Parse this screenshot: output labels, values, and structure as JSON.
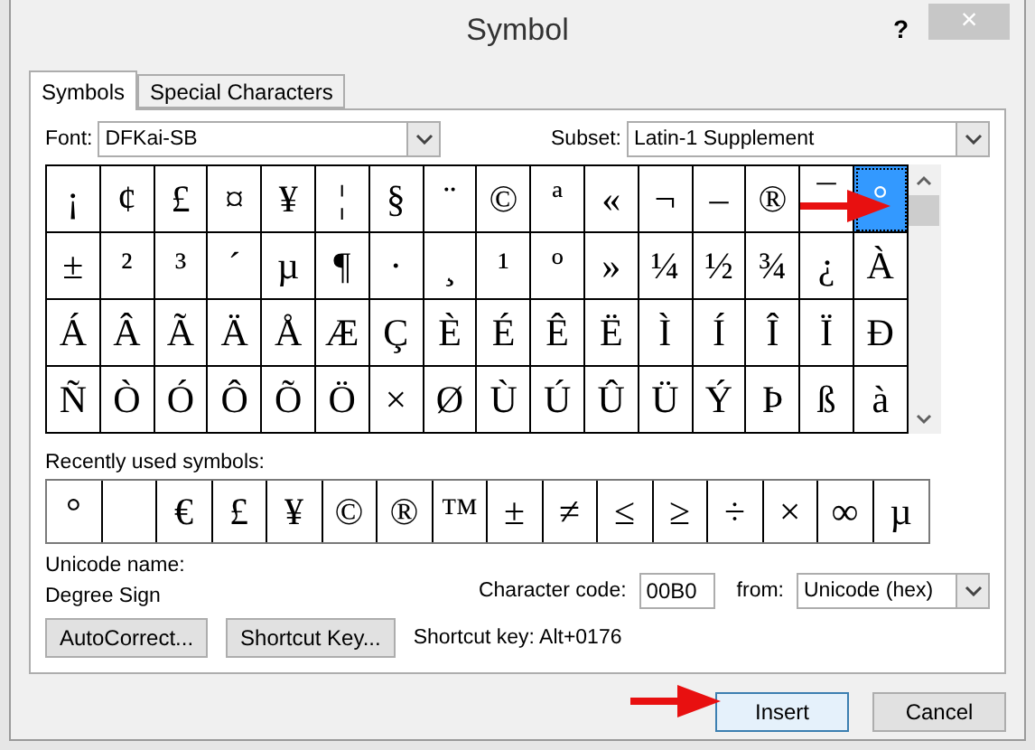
{
  "window": {
    "title": "Symbol",
    "help": "?",
    "close": "×"
  },
  "tabs": [
    {
      "label": "Symbols",
      "selected": true
    },
    {
      "label": "Special Characters",
      "selected": false
    }
  ],
  "font": {
    "label": "Font:",
    "value": "DFKai-SB"
  },
  "subset": {
    "label": "Subset:",
    "value": "Latin-1 Supplement"
  },
  "grid": [
    [
      {
        "char": "¡",
        "selected": false
      },
      {
        "char": "¢",
        "selected": false
      },
      {
        "char": "£",
        "selected": false
      },
      {
        "char": "¤",
        "selected": false
      },
      {
        "char": "¥",
        "selected": false
      },
      {
        "char": "¦",
        "selected": false
      },
      {
        "char": "§",
        "selected": false
      },
      {
        "char": "¨",
        "selected": false
      },
      {
        "char": "©",
        "selected": false
      },
      {
        "char": "ª",
        "selected": false
      },
      {
        "char": "«",
        "selected": false
      },
      {
        "char": "¬",
        "selected": false
      },
      {
        "char": "–",
        "selected": false
      },
      {
        "char": "®",
        "selected": false
      },
      {
        "char": "¯",
        "selected": false
      },
      {
        "char": "°",
        "selected": true
      }
    ],
    [
      {
        "char": "±",
        "selected": false
      },
      {
        "char": "²",
        "selected": false
      },
      {
        "char": "³",
        "selected": false
      },
      {
        "char": "´",
        "selected": false
      },
      {
        "char": "µ",
        "selected": false
      },
      {
        "char": "¶",
        "selected": false
      },
      {
        "char": "·",
        "selected": false
      },
      {
        "char": "¸",
        "selected": false
      },
      {
        "char": "¹",
        "selected": false
      },
      {
        "char": "º",
        "selected": false
      },
      {
        "char": "»",
        "selected": false
      },
      {
        "char": "¼",
        "selected": false
      },
      {
        "char": "½",
        "selected": false
      },
      {
        "char": "¾",
        "selected": false
      },
      {
        "char": "¿",
        "selected": false
      },
      {
        "char": "À",
        "selected": false
      }
    ],
    [
      {
        "char": "Á",
        "selected": false
      },
      {
        "char": "Â",
        "selected": false
      },
      {
        "char": "Ã",
        "selected": false
      },
      {
        "char": "Ä",
        "selected": false
      },
      {
        "char": "Å",
        "selected": false
      },
      {
        "char": "Æ",
        "selected": false
      },
      {
        "char": "Ç",
        "selected": false
      },
      {
        "char": "È",
        "selected": false
      },
      {
        "char": "É",
        "selected": false
      },
      {
        "char": "Ê",
        "selected": false
      },
      {
        "char": "Ë",
        "selected": false
      },
      {
        "char": "Ì",
        "selected": false
      },
      {
        "char": "Í",
        "selected": false
      },
      {
        "char": "Î",
        "selected": false
      },
      {
        "char": "Ï",
        "selected": false
      },
      {
        "char": "Ð",
        "selected": false
      }
    ],
    [
      {
        "char": "Ñ",
        "selected": false
      },
      {
        "char": "Ò",
        "selected": false
      },
      {
        "char": "Ó",
        "selected": false
      },
      {
        "char": "Ô",
        "selected": false
      },
      {
        "char": "Õ",
        "selected": false
      },
      {
        "char": "Ö",
        "selected": false
      },
      {
        "char": "×",
        "selected": false
      },
      {
        "char": "Ø",
        "selected": false
      },
      {
        "char": "Ù",
        "selected": false
      },
      {
        "char": "Ú",
        "selected": false
      },
      {
        "char": "Û",
        "selected": false
      },
      {
        "char": "Ü",
        "selected": false
      },
      {
        "char": "Ý",
        "selected": false
      },
      {
        "char": "Þ",
        "selected": false
      },
      {
        "char": "ß",
        "selected": false
      },
      {
        "char": "à",
        "selected": false
      }
    ]
  ],
  "recent": {
    "label": "Recently used symbols:",
    "items": [
      {
        "kind": "symbol",
        "char": "°"
      },
      {
        "kind": "blank"
      },
      {
        "kind": "symbol",
        "char": "€"
      },
      {
        "kind": "symbol",
        "char": "£"
      },
      {
        "kind": "symbol",
        "char": "¥"
      },
      {
        "kind": "symbol",
        "char": "©"
      },
      {
        "kind": "symbol",
        "char": "®"
      },
      {
        "kind": "symbol",
        "char": "™"
      },
      {
        "kind": "symbol",
        "char": "±"
      },
      {
        "kind": "symbol",
        "char": "≠"
      },
      {
        "kind": "symbol",
        "char": "≤"
      },
      {
        "kind": "symbol",
        "char": "≥"
      },
      {
        "kind": "symbol",
        "char": "÷"
      },
      {
        "kind": "symbol",
        "char": "×"
      },
      {
        "kind": "symbol",
        "char": "∞"
      },
      {
        "kind": "symbol",
        "char": "µ"
      }
    ]
  },
  "unicode_name": {
    "label": "Unicode name:",
    "value": "Degree Sign"
  },
  "character_code": {
    "label": "Character code:",
    "value": "00B0"
  },
  "from": {
    "label": "from:",
    "value": "Unicode (hex)"
  },
  "buttons": [
    {
      "label": "AutoCorrect..."
    },
    {
      "label": "Shortcut Key..."
    }
  ],
  "shortcut_text": "Shortcut key: Alt+0176",
  "footer_buttons": [
    {
      "label": "Insert",
      "kind": "default"
    },
    {
      "label": "Cancel",
      "kind": "normal"
    }
  ]
}
